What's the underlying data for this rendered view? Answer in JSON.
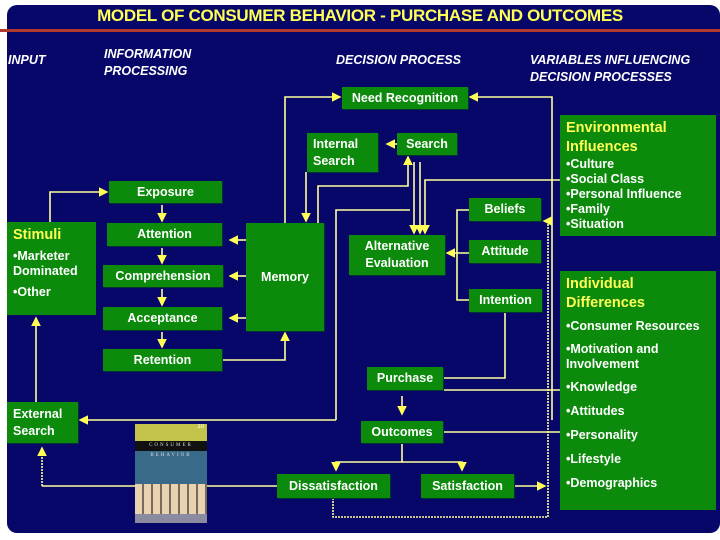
{
  "title": "MODEL OF CONSUMER BEHAVIOR - PURCHASE AND OUTCOMES",
  "headers": {
    "input": "INPUT",
    "info": "INFORMATION PROCESSING",
    "decision": "DECISION PROCESS",
    "variables": "VARIABLES INFLUENCING DECISION PROCESSES"
  },
  "boxes": {
    "need": "Need Recognition",
    "internal": "Internal Search",
    "search": "Search",
    "exposure": "Exposure",
    "beliefs": "Beliefs",
    "attention": "Attention",
    "memory": "Memory",
    "alt": "Alternative Evaluation",
    "attitude": "Attitude",
    "comprehension": "Comprehension",
    "intention": "Intention",
    "acceptance": "Acceptance",
    "retention": "Retention",
    "purchase": "Purchase",
    "external": "External Search",
    "outcomes": "Outcomes",
    "dissatisfaction": "Dissatisfaction",
    "satisfaction": "Satisfaction"
  },
  "stimuli": {
    "heading": "Stimuli",
    "items": [
      "•Marketer Dominated",
      "•Other"
    ]
  },
  "environmental": {
    "heading": "Environmental Influences",
    "items": [
      "•Culture",
      "•Social Class",
      "•Personal Influence",
      "•Family",
      "•Situation"
    ]
  },
  "individual": {
    "heading": "Individual Differences",
    "items": [
      "•Consumer Resources",
      "•Motivation and Involvement",
      "•Knowledge",
      "•Attitudes",
      "•Personality",
      "•Lifestyle",
      "•Demographics"
    ]
  },
  "book": {
    "title": "CONSUMER BEHAVIOR",
    "edition": "10"
  },
  "colors": {
    "background": "#07076a",
    "box": "#0b8a0b",
    "title": "#ffff55",
    "line": "#ffff99"
  }
}
